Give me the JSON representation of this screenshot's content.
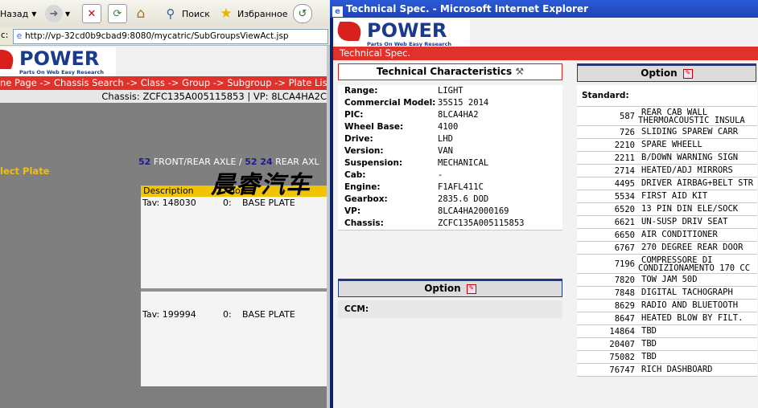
{
  "left_browser": {
    "toolbar": {
      "back_label": "Назад",
      "search_label": "Поиск",
      "favorites_label": "Избранное"
    },
    "address": {
      "label": "с:",
      "url": "http://vp-32cd0b9cbad9:8080/mycatric/SubGroupsViewAct.jsp"
    },
    "logo": {
      "word": "POWER",
      "tagline": "Parts On Web Easy Research"
    },
    "breadcrumb": "ne Page -> Chassis Search -> Class -> Group -> Subgroup -> Plate Lis",
    "chassis_line": "Chassis: ZCFC135A005115853 | VP: 8LCA4HA2C",
    "select_plate": "lect Plate",
    "axle": {
      "num1": "52",
      "text1": "FRONT/REAR AXLE /",
      "num2": "52 24",
      "text2": "REAR AXL"
    },
    "description_header": "Description",
    "description_header_2": "ion",
    "plates": [
      {
        "tav": "Tav: 148030",
        "qty": "0:",
        "name": "BASE PLATE"
      },
      {
        "tav": "Tav: 199994",
        "qty": "0:",
        "name": "BASE PLATE"
      }
    ],
    "watermark": "晨睿汽车"
  },
  "right_browser": {
    "title": "Technical Spec. - Microsoft Internet Explorer",
    "logo": {
      "word": "POWER",
      "tagline": "Parts On Web Easy Research"
    },
    "header_bar": "Technical Spec.",
    "tech_title": "Technical Characteristics",
    "characteristics": [
      {
        "key": "Range:",
        "value": "LIGHT"
      },
      {
        "key": "Commercial Model:",
        "value": "35S15 2014"
      },
      {
        "key": "PIC:",
        "value": "8LCA4HA2"
      },
      {
        "key": "Wheel Base:",
        "value": "4100"
      },
      {
        "key": "Drive:",
        "value": "LHD"
      },
      {
        "key": "Version:",
        "value": "VAN"
      },
      {
        "key": "Suspension:",
        "value": "MECHANICAL"
      },
      {
        "key": "Cab:",
        "value": "-"
      },
      {
        "key": "Engine:",
        "value": "F1AFL411C"
      },
      {
        "key": "Gearbox:",
        "value": "2835.6 DOD"
      },
      {
        "key": "VP:",
        "value": "8LCA4HA2000169"
      },
      {
        "key": "Chassis:",
        "value": "ZCFC135A005115853"
      }
    ],
    "option_title": "Option",
    "ccm_label": "CCM:",
    "option_right_title": "Option",
    "standard_label": "Standard:",
    "options": [
      {
        "code": "587",
        "desc": "REAR CAB WALL",
        "desc2": "THERMOACOUSTIC INSULA"
      },
      {
        "code": "726",
        "desc": "SLIDING SPAREW CARR"
      },
      {
        "code": "2210",
        "desc": "SPARE WHEELL"
      },
      {
        "code": "2211",
        "desc": "B/DOWN WARNING SIGN"
      },
      {
        "code": "2714",
        "desc": "HEATED/ADJ MIRRORS"
      },
      {
        "code": "4495",
        "desc": "DRIVER AIRBAG+BELT STR"
      },
      {
        "code": "5534",
        "desc": "FIRST AID KIT"
      },
      {
        "code": "6520",
        "desc": "13 PIN DIN ELE/SOCK"
      },
      {
        "code": "6621",
        "desc": "UN-SUSP DRIV SEAT"
      },
      {
        "code": "6650",
        "desc": "AIR CONDITIONER"
      },
      {
        "code": "6767",
        "desc": "270 DEGREE REAR DOOR"
      },
      {
        "code": "7196",
        "desc": "COMPRESSORE DI",
        "desc2": "CONDIZIONAMENTO 170 CC"
      },
      {
        "code": "7820",
        "desc": "TOW JAM 50D"
      },
      {
        "code": "7848",
        "desc": "DIGITAL TACHOGRAPH"
      },
      {
        "code": "8629",
        "desc": "RADIO AND BLUETOOTH"
      },
      {
        "code": "8647",
        "desc": "HEATED BLOW BY FILT."
      },
      {
        "code": "14864",
        "desc": "TBD"
      },
      {
        "code": "20407",
        "desc": "TBD"
      },
      {
        "code": "75082",
        "desc": "TBD"
      },
      {
        "code": "76747",
        "desc": "RICH DASHBOARD"
      }
    ]
  }
}
